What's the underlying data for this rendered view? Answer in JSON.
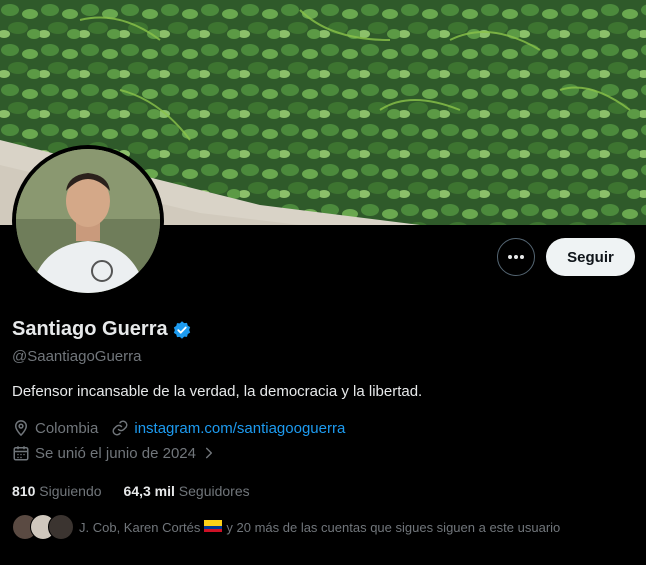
{
  "profile": {
    "display_name": "Santiago Guerra",
    "handle": "@SaantiagoGuerra",
    "bio": "Defensor incansable de la verdad, la democracia y la libertad.",
    "location": "Colombia",
    "website": "instagram.com/santiagooguerra",
    "joined": "Se unió el junio de 2024",
    "verified_color": "#1d9bf0"
  },
  "actions": {
    "more_icon": "more-icon",
    "follow_label": "Seguir"
  },
  "stats": {
    "following_count": "810",
    "following_label": "Siguiendo",
    "followers_count": "64,3 mil",
    "followers_label": "Seguidores"
  },
  "mutuals": {
    "names": "J. Cob, Karen Cortés",
    "rest": "y 20 más de las cuentas que sigues siguen a este usuario"
  },
  "colors": {
    "background": "#000000",
    "accent": "#1d9bf0",
    "secondary_text": "#71767b"
  }
}
